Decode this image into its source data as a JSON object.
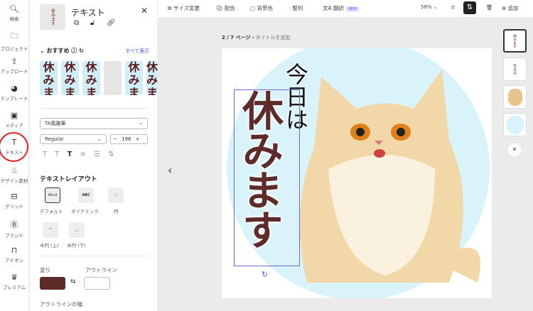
{
  "rail": [
    {
      "icon": "search",
      "label": "検索"
    },
    {
      "icon": "folder",
      "label": "プロジェクト"
    },
    {
      "icon": "upload",
      "label": "アップロード"
    },
    {
      "icon": "template",
      "label": "テンプレート"
    },
    {
      "icon": "media",
      "label": "メディア"
    },
    {
      "icon": "text",
      "label": "テキスト"
    },
    {
      "icon": "shapes",
      "label": "デザイン素材"
    },
    {
      "icon": "grid",
      "label": "グリッド"
    },
    {
      "icon": "brand",
      "label": "ブランド"
    },
    {
      "icon": "addon",
      "label": "アドオン"
    },
    {
      "icon": "premium",
      "label": "プレミアム"
    }
  ],
  "panel": {
    "title": "テキスト",
    "thumb_text": "休みます",
    "recommended": "おすすめ",
    "show_all": "すべて表示",
    "rec_text": "休みま",
    "font": "TA風雅筆",
    "weight": "Regular",
    "size": "198",
    "layout_title": "テキストレイアウト",
    "layouts": [
      "デフォルト",
      "ダイナミック",
      "円",
      "半円 (上)",
      "半円 (下)"
    ],
    "layout_icons": [
      "Abcd",
      "ABC"
    ],
    "fill": "塗り",
    "outline": "アウトライン",
    "outline_width": "アウトラインの幅",
    "fill_color": "#5e2b2b"
  },
  "toolbar": {
    "resize": "サイズ変更",
    "color": "配色",
    "bg": "背景色",
    "align": "整列",
    "translate": "翻訳",
    "new": "NEW",
    "zoom": "58%",
    "add": "追加"
  },
  "canvas": {
    "page_label": "2 / 7 ページ・",
    "page_title_placeholder": "タイトルを追加",
    "text_small": "今日は",
    "text_main": "休みます"
  },
  "pages": [
    {
      "text": "休みます"
    },
    {
      "text": "今日は"
    }
  ]
}
